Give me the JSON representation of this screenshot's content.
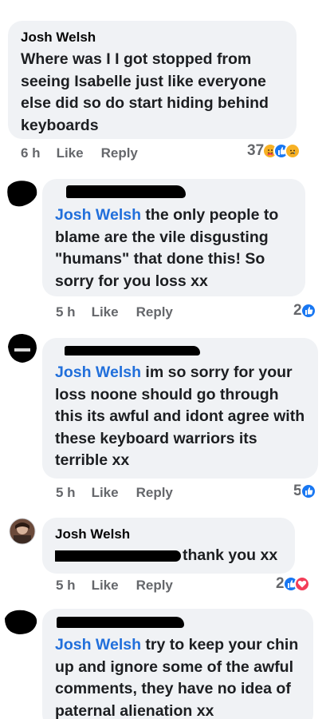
{
  "comments": [
    {
      "author": "Josh Welsh",
      "text": "Where was I I got stopped from seeing Isabelle just like everyone else did so do start hiding behind keyboards",
      "time": "6 h",
      "like_label": "Like",
      "reply_label": "Reply",
      "reaction_count": "37",
      "reactions": [
        "care-icon",
        "like-icon",
        "sad-icon"
      ]
    },
    {
      "tag": "Josh Welsh",
      "text": " the only people to blame are the vile disgusting \"humans\" that done this! So sorry for you loss xx",
      "time": "5 h",
      "like_label": "Like",
      "reply_label": "Reply",
      "reaction_count": "2",
      "reactions": [
        "like-icon"
      ]
    },
    {
      "tag": "Josh Welsh",
      "text": " im so sorry for your loss noone should go through this its awful and idont agree with these keyboard warriors its terrible xx",
      "time": "5 h",
      "like_label": "Like",
      "reply_label": "Reply",
      "reaction_count": "5",
      "reactions": [
        "like-icon"
      ]
    },
    {
      "author": "Josh Welsh",
      "text": "thank you xx",
      "time": "5 h",
      "like_label": "Like",
      "reply_label": "Reply",
      "reaction_count": "2",
      "reactions": [
        "like-icon",
        "love-icon"
      ]
    },
    {
      "tag": "Josh Welsh",
      "text": " try to keep your chin up and ignore some of the awful comments, they have no idea of paternal alienation xx"
    }
  ],
  "colors": {
    "bubble": "#f0f2f5",
    "tag": "#216fdb",
    "like": "#1877f2",
    "love": "#f33e58",
    "meta": "#65676b"
  }
}
